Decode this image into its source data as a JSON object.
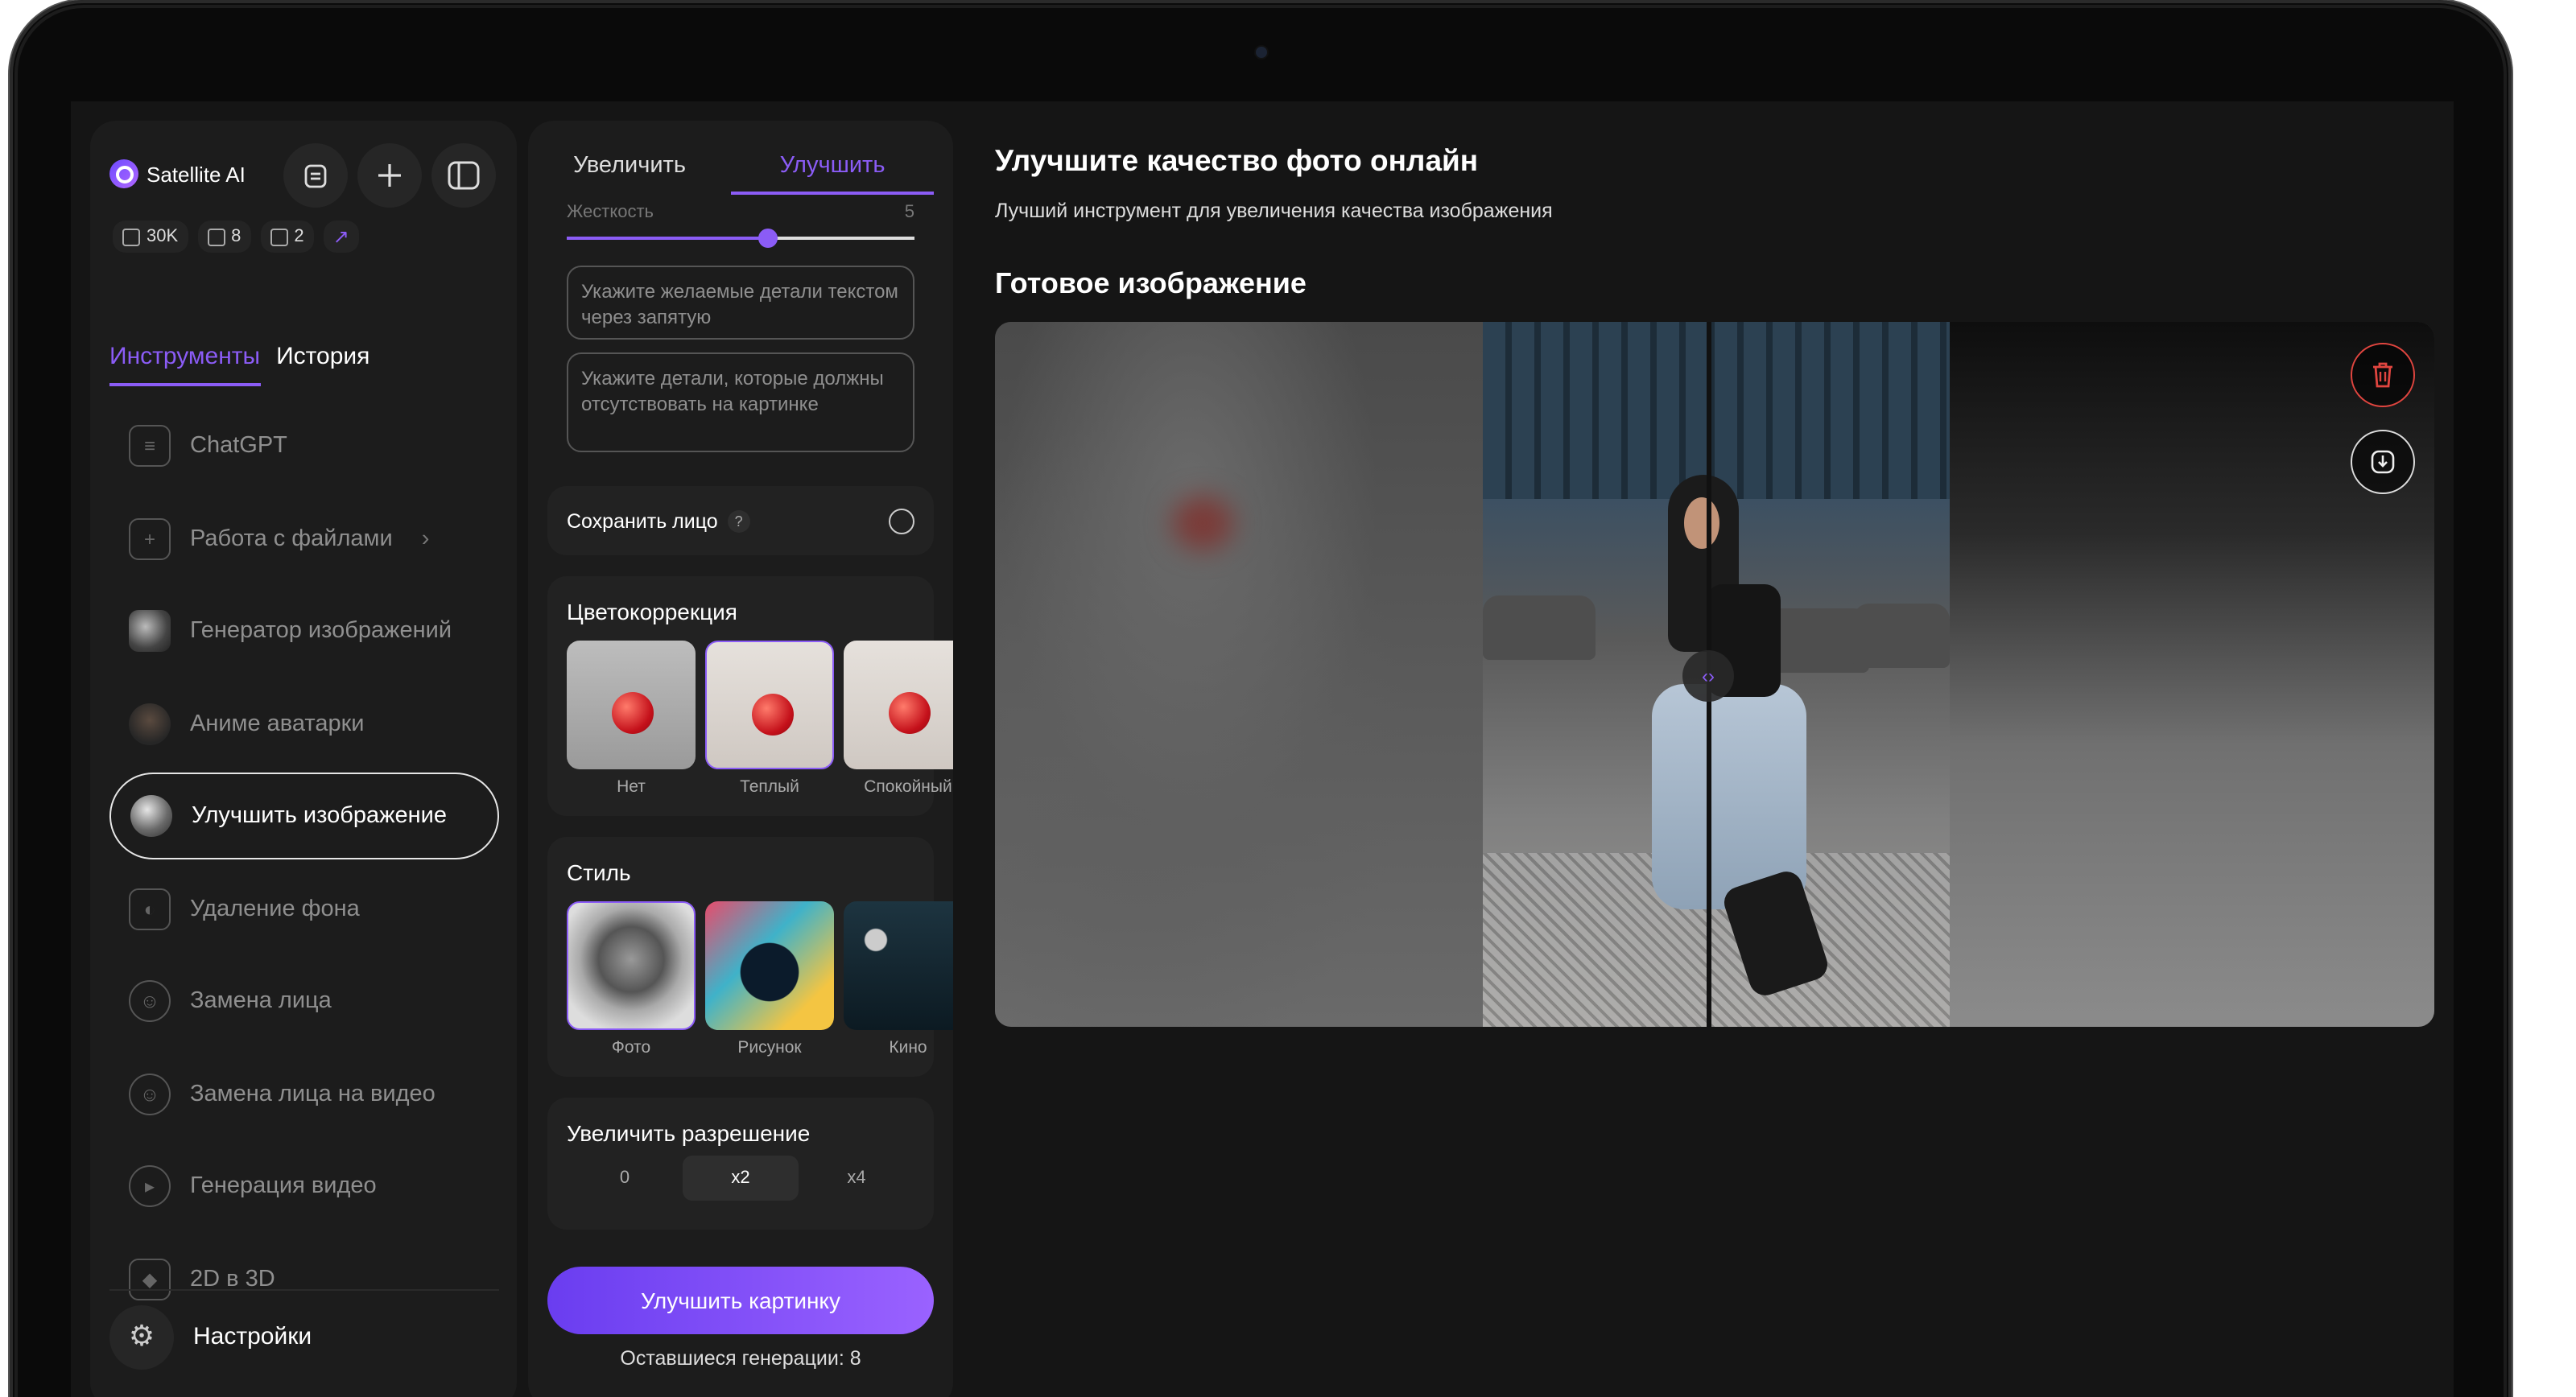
{
  "app": {
    "brand": "Satellite AI",
    "stats": [
      {
        "icon": "document-icon",
        "value": "30K"
      },
      {
        "icon": "image-icon",
        "value": "8"
      },
      {
        "icon": "video-icon",
        "value": "2"
      }
    ],
    "stats_link_icon": "arrow-up-right-icon",
    "top_buttons": [
      "clipboard-icon",
      "plus-icon",
      "sidebar-toggle-icon"
    ]
  },
  "sidebar": {
    "tabs": [
      "Инструменты",
      "История"
    ],
    "active_tab": "Инструменты",
    "items": [
      {
        "label": "ChatGPT",
        "icon": "document-icon"
      },
      {
        "label": "Работа с файлами",
        "icon": "file-plus-icon",
        "chevron": "›"
      },
      {
        "label": "Генератор изображений",
        "icon": "sphere-image-icon"
      },
      {
        "label": "Аниме аватарки",
        "icon": "avatar-image-icon"
      },
      {
        "label": "Улучшить изображение",
        "icon": "sphere-image-icon",
        "active": true
      },
      {
        "label": "Удаление фона",
        "icon": "person-frame-icon"
      },
      {
        "label": "Замена лица",
        "icon": "face-icon"
      },
      {
        "label": "Замена лица на видео",
        "icon": "face-icon"
      },
      {
        "label": "Генерация видео",
        "icon": "video-icon"
      },
      {
        "label": "2D в 3D",
        "icon": "cube-icon"
      }
    ],
    "settings_label": "Настройки"
  },
  "panel": {
    "tabs": [
      "Увеличить",
      "Улучшить"
    ],
    "active_tab": "Улучшить",
    "slider": {
      "label": "Жесткость",
      "value": "5",
      "fill": 0.58
    },
    "desired_placeholder": "Укажите желаемые детали текстом через запятую",
    "negative_placeholder": "Укажите детали, которые должны отсутствовать на картинке",
    "keep_face_label": "Сохранить лицо",
    "help": "?",
    "color_title": "Цветокоррекция",
    "color_options": [
      "Нет",
      "Теплый",
      "Спокойный"
    ],
    "style_title": "Стиль",
    "style_options": [
      "Фото",
      "Рисунок",
      "Кино"
    ],
    "res_title": "Увеличить разрешение",
    "res_options": [
      "0",
      "x2",
      "x4"
    ],
    "res_selected": "x2",
    "cta_label": "Улучшить картинку",
    "remaining": "Оставшиеся генерации: 8"
  },
  "main": {
    "title": "Улучшите качество фото онлайн",
    "subtitle": "Лучший инструмент для увеличения качества изображения",
    "result_title": "Готовое изображение",
    "handle_glyph": "‹›",
    "actions": [
      "trash-icon",
      "download-icon"
    ]
  },
  "colors": {
    "accent": "#8b5cf6",
    "danger": "#e0453f",
    "bg": "#151515",
    "panel": "#1c1c1c"
  }
}
